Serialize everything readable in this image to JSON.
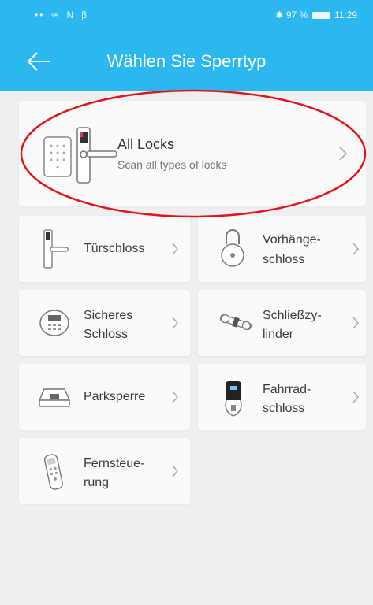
{
  "status_bar": {
    "left_icons": " •• ≋ N β",
    "bluetooth": "✱",
    "battery": "97 %",
    "time": "11:29"
  },
  "header": {
    "title": "Wählen Sie Sperrtyp",
    "back_icon": "arrow-left-icon"
  },
  "all_locks": {
    "title": "All Locks",
    "subtitle": "Scan all types of locks"
  },
  "lock_types": [
    {
      "label_line1": "Türschloss",
      "label_line2": "",
      "icon": "door-lock-icon"
    },
    {
      "label_line1": "Vorhänge-",
      "label_line2": "schloss",
      "icon": "padlock-icon"
    },
    {
      "label_line1": "Sicheres",
      "label_line2": "Schloss",
      "icon": "safe-lock-icon"
    },
    {
      "label_line1": "Schließzy-",
      "label_line2": "linder",
      "icon": "lock-cylinder-icon"
    },
    {
      "label_line1": "Parksperre",
      "label_line2": "",
      "icon": "parking-lock-icon"
    },
    {
      "label_line1": "Fahrrad-",
      "label_line2": "schloss",
      "icon": "bike-lock-icon"
    },
    {
      "label_line1": "Fernsteue-",
      "label_line2": "rung",
      "icon": "remote-control-icon"
    }
  ],
  "colors": {
    "header": "#2bb8ef",
    "background": "#efeff2",
    "card": "#fafafa",
    "annotation": "#e0151b"
  }
}
